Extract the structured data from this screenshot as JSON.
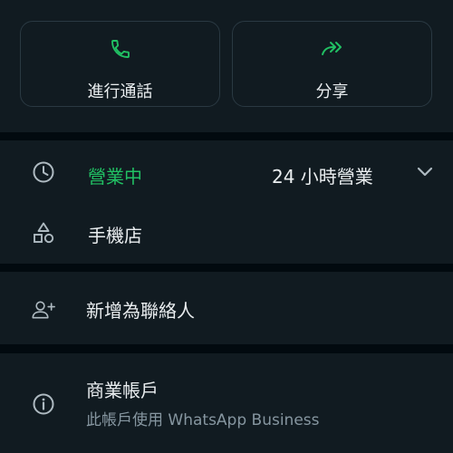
{
  "actions": {
    "call_label": "進行通話",
    "share_label": "分享"
  },
  "hours": {
    "status": "營業中",
    "detail": "24 小時營業"
  },
  "category": {
    "label": "手機店"
  },
  "contact": {
    "add_label": "新增為聯絡人"
  },
  "business": {
    "title": "商業帳戶",
    "subtitle": "此帳戶使用 WhatsApp Business"
  },
  "colors": {
    "accent": "#21c063",
    "background": "#111b21",
    "separator": "#020a0f",
    "text_primary": "#e9edef",
    "text_secondary": "#8696a0",
    "icon": "#aebac1"
  }
}
